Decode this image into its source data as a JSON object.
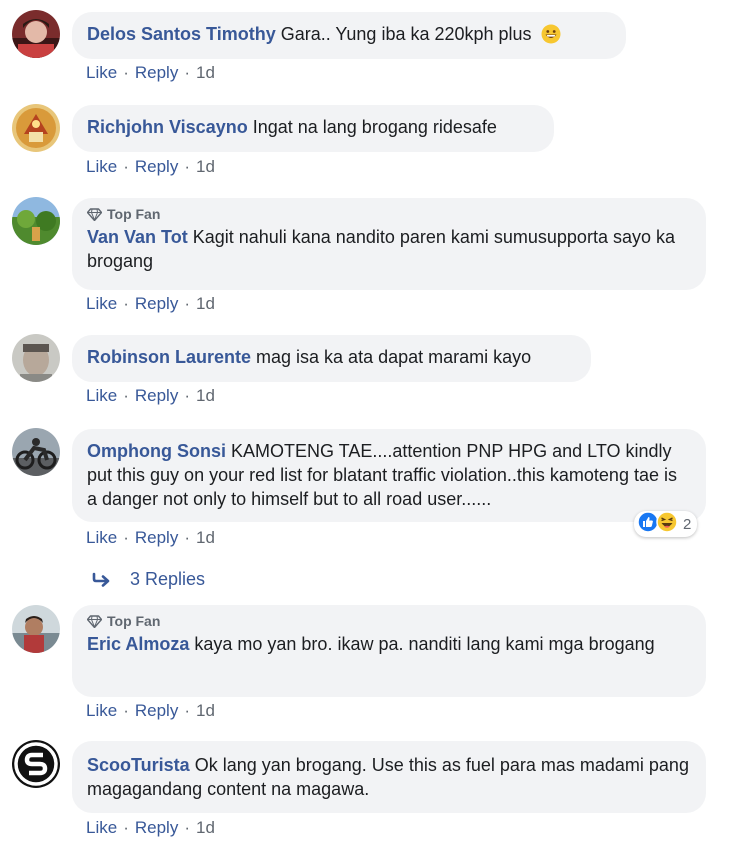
{
  "colors": {
    "author": "#385898",
    "text": "#1c1e21",
    "meta": "#606770",
    "bubble": "#f2f3f5"
  },
  "actions": {
    "like": "Like",
    "reply": "Reply",
    "separator": "·"
  },
  "top_fan_badge": "Top Fan",
  "comments": [
    {
      "author": "Delos Santos Timothy",
      "text": "Gara.. Yung iba ka 220kph plus",
      "emoji": "grinning-face",
      "time": "1d"
    },
    {
      "author": "Richjohn Viscayno",
      "text": "Ingat na lang brogang ridesafe",
      "time": "1d"
    },
    {
      "author": "Van Van Tot",
      "text": "Kagit nahuli kana nandito paren kami sumusupporta sayo ka brogang",
      "top_fan": true,
      "time": "1d"
    },
    {
      "author": "Robinson Laurente",
      "text": "mag isa ka ata dapat marami kayo",
      "time": "1d"
    },
    {
      "author": "Omphong Sonsi",
      "text": "KAMOTENG TAE....attention PNP HPG and LTO kindly put this guy on your red list for blatant traffic violation..this kamoteng tae is a danger not only to himself but to all road user......",
      "time": "1d",
      "reactions": {
        "icons": [
          "like",
          "haha"
        ],
        "count": "2"
      },
      "replies_label": "3 Replies"
    },
    {
      "author": "Eric Almoza",
      "text": "kaya mo yan bro. ikaw pa. nanditi lang kami mga brogang",
      "top_fan": true,
      "time": "1d"
    },
    {
      "author": "ScooTurista",
      "text": "Ok lang yan brogang. Use this as fuel para mas madami pang magagandang content na magawa.",
      "time": "1d"
    }
  ]
}
